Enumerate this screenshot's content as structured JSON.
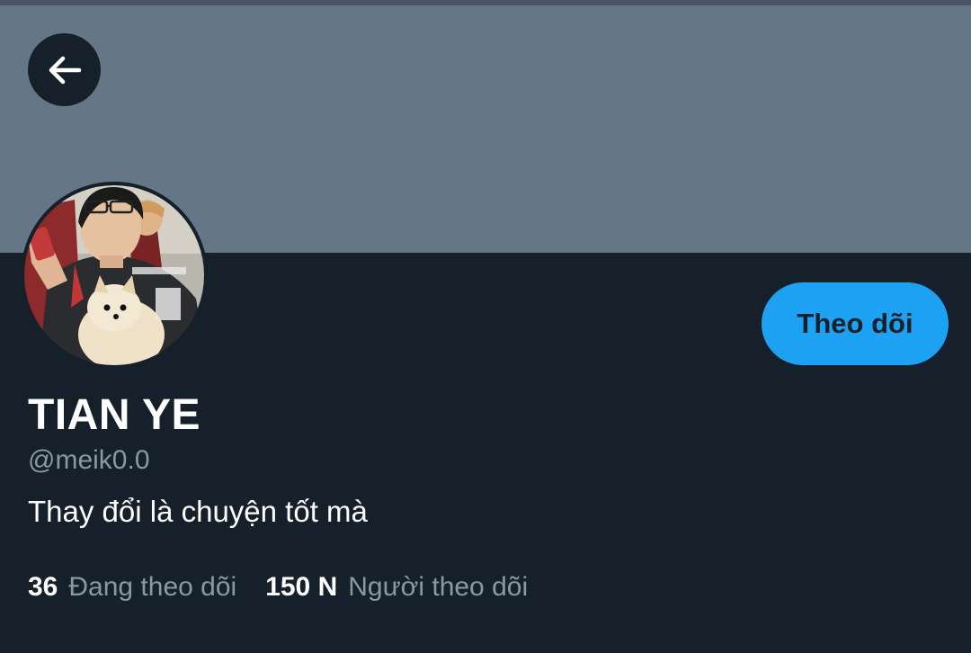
{
  "header": {
    "back_icon": "arrow-left-icon"
  },
  "colors": {
    "background": "#15202b",
    "banner": "#657786",
    "accent": "#1da1f2",
    "secondary_text": "#8899a6"
  },
  "profile": {
    "name": "TIAN YE",
    "handle": "@meik0.0",
    "bio": "Thay đổi là chuyện tốt mà",
    "follow_label": "Theo dõi",
    "avatar_description": "avatar-photo"
  },
  "stats": {
    "following_count": "36",
    "following_label": "Đang theo dõi",
    "followers_count": "150 N",
    "followers_label": "Người theo dõi"
  }
}
